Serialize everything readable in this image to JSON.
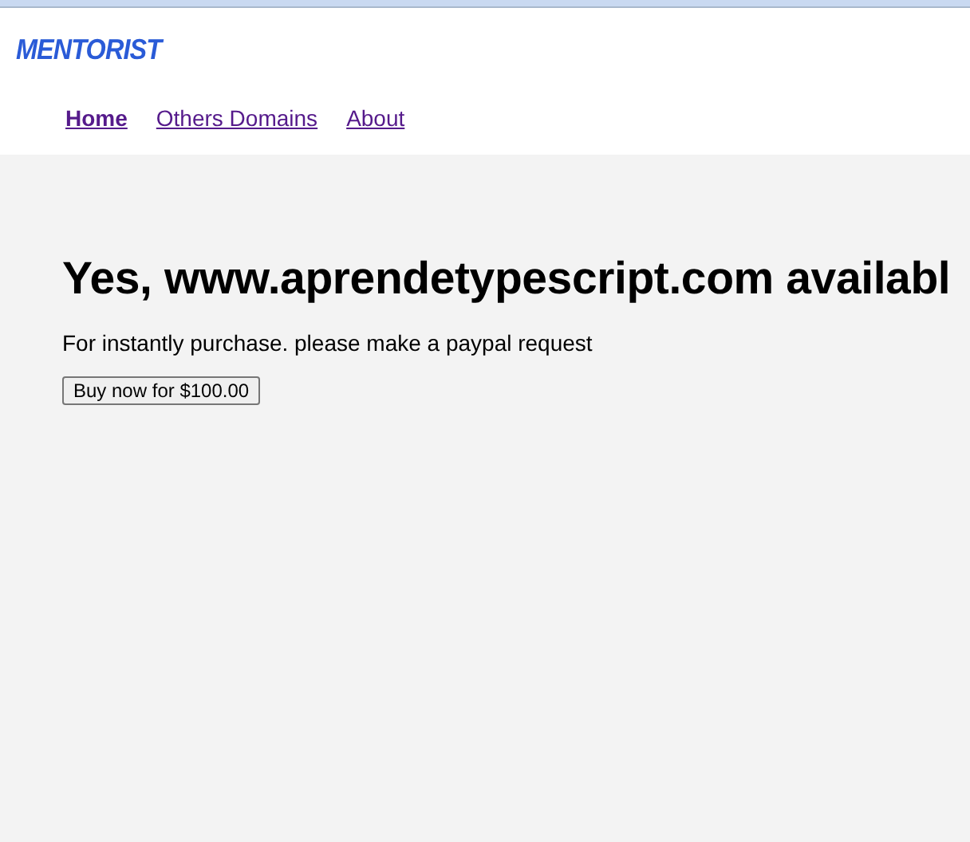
{
  "logo": "MENTORIST",
  "nav": [
    {
      "label": "Home",
      "selected": true
    },
    {
      "label": "Others Domains",
      "selected": false
    },
    {
      "label": "About",
      "selected": false
    }
  ],
  "heading": "Yes, www.aprendetypescript.com availabl",
  "message": "For instantly purchase. please make a paypal request",
  "buy_button": "Buy now for $100.00"
}
